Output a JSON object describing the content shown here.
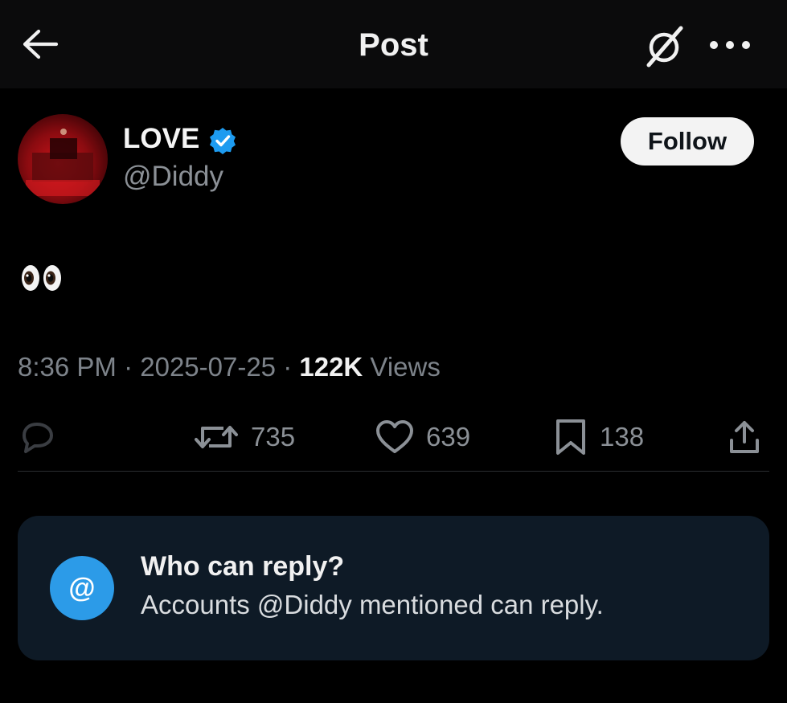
{
  "header": {
    "title": "Post",
    "back_icon": "arrow-left-icon",
    "grok_icon": "grok-icon",
    "more_icon": "more-horizontal-icon"
  },
  "author": {
    "name": "LOVE",
    "handle": "@Diddy",
    "verified": true,
    "follow_label": "Follow"
  },
  "post": {
    "content_emoji": "eyes",
    "time": "8:36 PM",
    "separator": " · ",
    "date": "2025-07-25",
    "views_count": "122K",
    "views_label": " Views"
  },
  "actions": {
    "reply_icon": "reply-icon",
    "repost_count": "735",
    "like_count": "639",
    "bookmark_count": "138",
    "share_icon": "share-icon"
  },
  "reply_restriction": {
    "badge_symbol": "@",
    "title": "Who can reply?",
    "description": "Accounts @Diddy mentioned can reply."
  },
  "colors": {
    "background": "#000000",
    "accent_blue": "#1d9bf0",
    "card_background": "#0e1a26",
    "muted_text": "#8b9096"
  }
}
